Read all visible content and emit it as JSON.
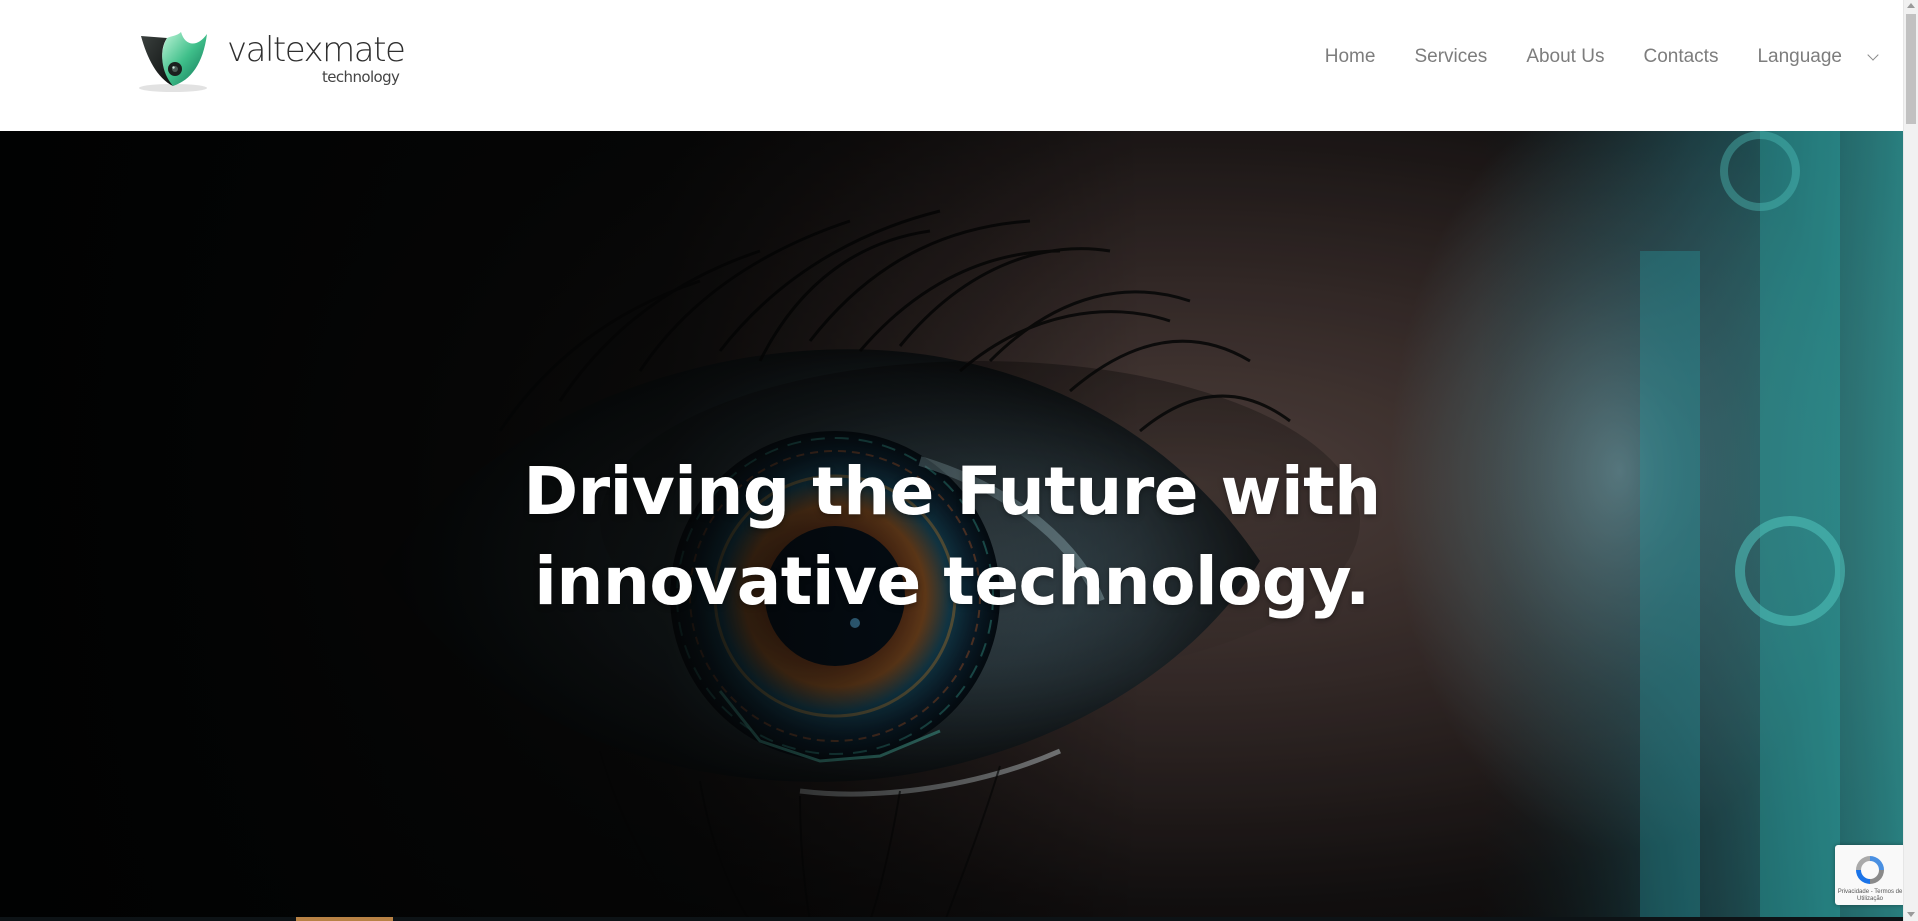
{
  "brand": {
    "name": "valtexmate",
    "tagline": "technology",
    "colors": {
      "mark_dark": "#1b1f1e",
      "mark_green": "#3fbf8a",
      "text": "#2f2f2f"
    }
  },
  "nav": {
    "items": [
      {
        "label": "Home"
      },
      {
        "label": "Services"
      },
      {
        "label": "About Us"
      },
      {
        "label": "Contacts"
      }
    ],
    "language": {
      "label": "Language",
      "icon": "chevron-down-icon"
    }
  },
  "hero": {
    "title_line1": "Driving the Future with",
    "title_line2": "innovative technology."
  },
  "recaptcha": {
    "footer_text": "Privacidade - Termos de Utilização",
    "icon": "recaptcha-icon"
  },
  "colors": {
    "nav_text": "#7d7d7d",
    "hero_text": "#ffffff",
    "accent_teal": "#31c7c9"
  }
}
